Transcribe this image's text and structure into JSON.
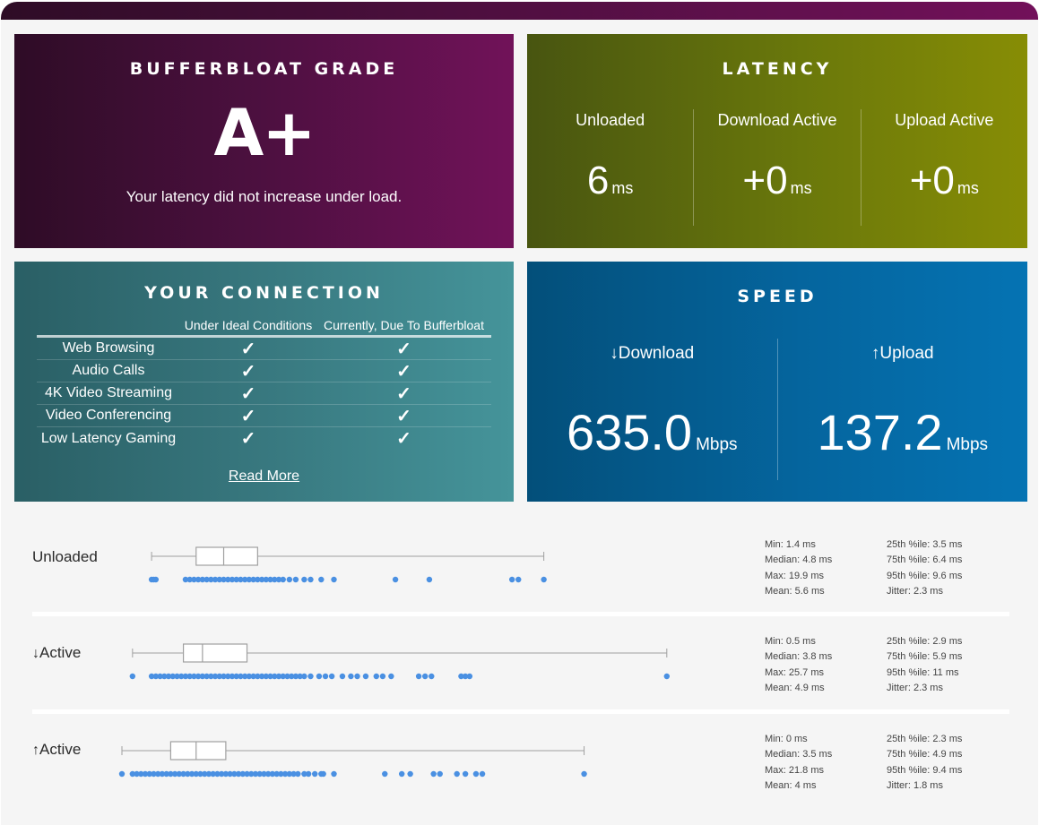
{
  "grade": {
    "title": "BUFFERBLOAT GRADE",
    "letter": "A+",
    "description": "Your latency did not increase under load."
  },
  "latency": {
    "title": "LATENCY",
    "columns": [
      {
        "label": "Unloaded",
        "value": "6",
        "unit": "ms"
      },
      {
        "label": "Download Active",
        "value": "+0",
        "unit": "ms"
      },
      {
        "label": "Upload Active",
        "value": "+0",
        "unit": "ms"
      }
    ]
  },
  "connection": {
    "title": "YOUR CONNECTION",
    "headers": [
      "",
      "Under Ideal Conditions",
      "Currently, Due To Bufferbloat"
    ],
    "rows": [
      {
        "name": "Web Browsing",
        "ideal": "✓",
        "current": "✓"
      },
      {
        "name": "Audio Calls",
        "ideal": "✓",
        "current": "✓"
      },
      {
        "name": "4K Video Streaming",
        "ideal": "✓",
        "current": "✓"
      },
      {
        "name": "Video Conferencing",
        "ideal": "✓",
        "current": "✓"
      },
      {
        "name": "Low Latency Gaming",
        "ideal": "✓",
        "current": "✓"
      }
    ],
    "read_more": "Read More"
  },
  "speed": {
    "title": "SPEED",
    "download": {
      "arrow": "↓",
      "label": "Download",
      "value": "635.0",
      "unit": "Mbps"
    },
    "upload": {
      "arrow": "↑",
      "label": "Upload",
      "value": "137.2",
      "unit": "Mbps"
    }
  },
  "colors": {
    "grade": "#4d1040",
    "latency": "#6a780b",
    "connection": "#38787f",
    "speed": "#05659e",
    "dot": "#4a90e2",
    "box_stroke": "#a0a0a0"
  },
  "chart_data": {
    "type": "boxplot",
    "unit": "ms",
    "series": [
      {
        "name": "Unloaded",
        "arrow": "",
        "min": 1.4,
        "q1": 3.5,
        "median": 4.8,
        "q3": 6.4,
        "max": 19.9,
        "stats": {
          "min": "Min: 1.4 ms",
          "median": "Median: 4.8 ms",
          "max": "Max: 19.9 ms",
          "mean": "Mean: 5.6 ms",
          "p25": "25th %ile: 3.5 ms",
          "p75": "75th %ile: 6.4 ms",
          "p95": "95th %ile: 9.6 ms",
          "jitter": "Jitter: 2.3 ms"
        },
        "points": [
          1.4,
          1.5,
          1.6,
          3.0,
          3.2,
          3.4,
          3.6,
          3.8,
          4.0,
          4.2,
          4.4,
          4.6,
          4.8,
          5.0,
          5.2,
          5.4,
          5.6,
          5.8,
          6.0,
          6.2,
          6.4,
          6.6,
          6.8,
          7.0,
          7.2,
          7.4,
          7.6,
          7.9,
          8.2,
          8.6,
          8.9,
          9.4,
          10.0,
          12.9,
          14.5,
          18.4,
          18.7,
          19.9
        ]
      },
      {
        "name": "Active",
        "arrow": "↓",
        "min": 0.5,
        "q1": 2.9,
        "median": 3.8,
        "q3": 5.9,
        "max": 25.7,
        "stats": {
          "min": "Min: 0.5 ms",
          "median": "Median: 3.8 ms",
          "max": "Max: 25.7 ms",
          "mean": "Mean: 4.9 ms",
          "p25": "25th %ile: 2.9 ms",
          "p75": "75th %ile: 5.9 ms",
          "p95": "95th %ile: 11 ms",
          "jitter": "Jitter: 2.3 ms"
        },
        "points": [
          0.5,
          1.4,
          1.6,
          1.8,
          2.0,
          2.2,
          2.4,
          2.6,
          2.8,
          3.0,
          3.2,
          3.4,
          3.6,
          3.8,
          4.0,
          4.2,
          4.4,
          4.6,
          4.8,
          5.0,
          5.2,
          5.4,
          5.6,
          5.8,
          6.0,
          6.2,
          6.4,
          6.6,
          6.8,
          7.0,
          7.2,
          7.4,
          7.6,
          7.8,
          8.0,
          8.2,
          8.4,
          8.6,
          8.9,
          9.3,
          9.6,
          9.9,
          10.4,
          10.8,
          11.1,
          11.5,
          12.0,
          12.3,
          12.7,
          14.0,
          14.3,
          14.6,
          16.0,
          16.2,
          16.4,
          25.7
        ]
      },
      {
        "name": "Active",
        "arrow": "↑",
        "min": 0,
        "q1": 2.3,
        "median": 3.5,
        "q3": 4.9,
        "max": 21.8,
        "stats": {
          "min": "Min: 0 ms",
          "median": "Median: 3.5 ms",
          "max": "Max: 21.8 ms",
          "mean": "Mean: 4 ms",
          "p25": "25th %ile: 2.3 ms",
          "p75": "75th %ile: 4.9 ms",
          "p95": "95th %ile: 9.4 ms",
          "jitter": "Jitter: 1.8 ms"
        },
        "points": [
          0,
          0.5,
          0.7,
          0.9,
          1.1,
          1.3,
          1.5,
          1.7,
          1.9,
          2.1,
          2.3,
          2.5,
          2.7,
          2.9,
          3.1,
          3.3,
          3.5,
          3.7,
          3.9,
          4.1,
          4.3,
          4.5,
          4.7,
          4.9,
          5.1,
          5.3,
          5.5,
          5.7,
          5.9,
          6.1,
          6.3,
          6.5,
          6.7,
          6.9,
          7.1,
          7.3,
          7.5,
          7.7,
          7.9,
          8.1,
          8.3,
          8.6,
          8.8,
          9.1,
          9.4,
          9.5,
          10.0,
          12.4,
          13.2,
          13.6,
          14.7,
          15.0,
          15.8,
          16.2,
          16.7,
          17.0,
          21.8
        ]
      }
    ]
  }
}
